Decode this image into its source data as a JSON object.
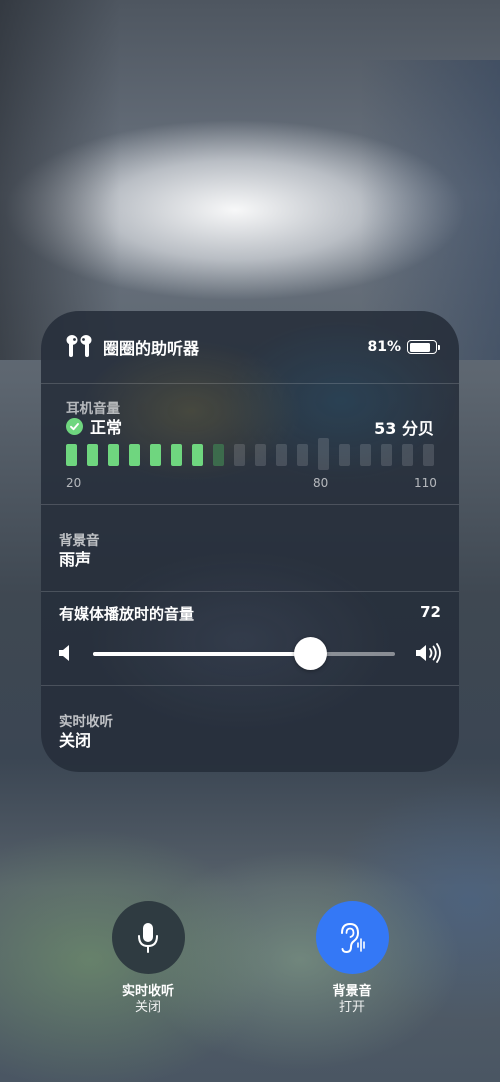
{
  "device": {
    "name": "圈圈的助听器",
    "battery_percent": "81%",
    "battery_level": 0.81
  },
  "headphone_volume": {
    "title": "耳机音量",
    "status": "正常",
    "level": "53 分贝",
    "meter": {
      "min": 20,
      "max": 110,
      "value_db": 53,
      "segments": 18,
      "active_segments": 7
    },
    "ticks": [
      "20",
      "80",
      "110"
    ],
    "colors": {
      "active": "#6fd67f",
      "dim_active": "#3c6b4c",
      "inactive": "rgba(255,255,255,0.14)"
    }
  },
  "background_sounds": {
    "title": "背景音",
    "value": "雨声"
  },
  "media_volume": {
    "title": "有媒体播放时的音量",
    "value": "72",
    "fraction": 0.72
  },
  "live_listen": {
    "title": "实时收听",
    "value": "关闭"
  },
  "controls": {
    "live_listen": {
      "label": "实时收听",
      "state": "关闭",
      "icon": "microphone-icon",
      "color": "#2f3b41"
    },
    "background_sounds": {
      "label": "背景音",
      "state": "打开",
      "icon": "ear-icon",
      "color": "#3478f6"
    }
  }
}
